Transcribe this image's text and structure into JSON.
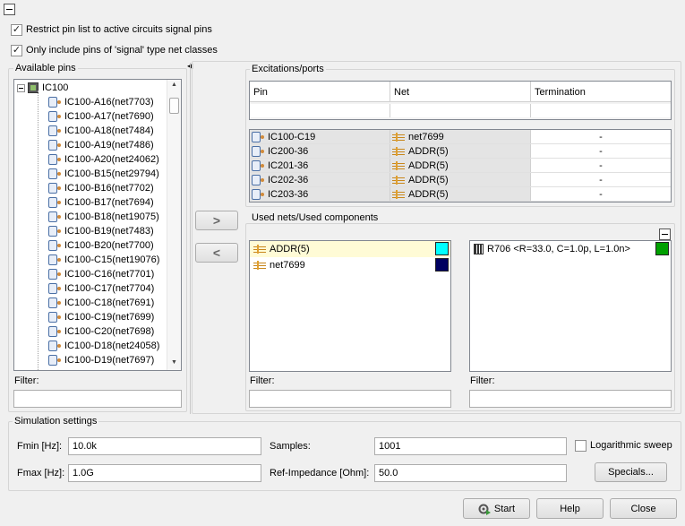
{
  "options": {
    "restrict_label": "Restrict pin list to active circuits signal pins",
    "restrict_checked": true,
    "signal_only_label": "Only include pins of 'signal' type net classes",
    "signal_only_checked": true
  },
  "available_pins": {
    "title": "Available pins",
    "root": "IC100",
    "pins": [
      "IC100-A16(net7703)",
      "IC100-A17(net7690)",
      "IC100-A18(net7484)",
      "IC100-A19(net7486)",
      "IC100-A20(net24062)",
      "IC100-B15(net29794)",
      "IC100-B16(net7702)",
      "IC100-B17(net7694)",
      "IC100-B18(net19075)",
      "IC100-B19(net7483)",
      "IC100-B20(net7700)",
      "IC100-C15(net19076)",
      "IC100-C16(net7701)",
      "IC100-C17(net7704)",
      "IC100-C18(net7691)",
      "IC100-C19(net7699)",
      "IC100-C20(net7698)",
      "IC100-D18(net24058)",
      "IC100-D19(net7697)"
    ],
    "filter_label": "Filter:",
    "filter_value": ""
  },
  "transfer": {
    "add_glyph": ">",
    "remove_glyph": "<"
  },
  "excitations": {
    "title": "Excitations/ports",
    "columns": [
      "Pin",
      "Net",
      "Termination"
    ],
    "rows": [
      {
        "pin": "IC100-C19",
        "net": "net7699",
        "termination": "-"
      },
      {
        "pin": "IC200-36",
        "net": "ADDR(5)",
        "termination": "-"
      },
      {
        "pin": "IC201-36",
        "net": "ADDR(5)",
        "termination": "-"
      },
      {
        "pin": "IC202-36",
        "net": "ADDR(5)",
        "termination": "-"
      },
      {
        "pin": "IC203-36",
        "net": "ADDR(5)",
        "termination": "-"
      }
    ]
  },
  "used": {
    "title": "Used nets/Used components",
    "nets": [
      {
        "name": "ADDR(5)",
        "color": "#00ffff"
      },
      {
        "name": "net7699",
        "color": "#000060"
      }
    ],
    "components": [
      {
        "name": "R706 <R=33.0, C=1.0p, L=1.0n>",
        "color": "#00a000"
      }
    ],
    "nets_filter_label": "Filter:",
    "components_filter_label": "Filter:"
  },
  "simulation": {
    "title": "Simulation settings",
    "fmin_label": "Fmin [Hz]:",
    "fmin_value": "10.0k",
    "fmax_label": "Fmax [Hz]:",
    "fmax_value": "1.0G",
    "samples_label": "Samples:",
    "samples_value": "1001",
    "refimp_label": "Ref-Impedance [Ohm]:",
    "refimp_value": "50.0",
    "log_sweep_label": "Logarithmic sweep",
    "log_sweep_checked": false,
    "specials_label": "Specials..."
  },
  "footer": {
    "start_label": "Start",
    "help_label": "Help",
    "close_label": "Close"
  }
}
